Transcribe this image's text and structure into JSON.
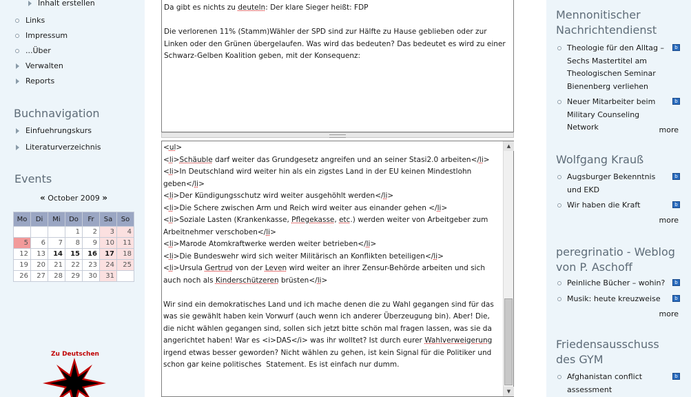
{
  "left_sidebar": {
    "top_item": "Inhalt erstellen",
    "nav_items": [
      {
        "label": "Links",
        "marker": "bullet"
      },
      {
        "label": "Impressum",
        "marker": "bullet"
      },
      {
        "label": "...Über",
        "marker": "bullet"
      },
      {
        "label": "Verwalten",
        "marker": "triangle"
      },
      {
        "label": "Reports",
        "marker": "triangle"
      }
    ],
    "book_nav": {
      "title": "Buchnavigation",
      "items": [
        "Einfuehrungskurs",
        "Literaturverzeichnis"
      ]
    },
    "events": {
      "title": "Events",
      "prev": "«",
      "next": "»",
      "month": "October 2009",
      "weekdays": [
        "Mo",
        "Di",
        "Mi",
        "Do",
        "Fr",
        "Sa",
        "So"
      ],
      "weeks": [
        [
          "",
          "",
          "",
          "1",
          "2",
          "3",
          "4"
        ],
        [
          "5",
          "6",
          "7",
          "8",
          "9",
          "10",
          "11"
        ],
        [
          "12",
          "13",
          "14",
          "15",
          "16",
          "17",
          "18"
        ],
        [
          "19",
          "20",
          "21",
          "22",
          "23",
          "24",
          "25"
        ],
        [
          "26",
          "27",
          "28",
          "29",
          "30",
          "31",
          ""
        ]
      ],
      "today": "5",
      "linked_days": [
        "14",
        "15",
        "16",
        "17"
      ]
    },
    "logo_caption": "Zu Deutschen"
  },
  "main": {
    "teaser": [
      "Da gibt es nichts zu deuteln: Der klare Sieger heißt: FDP",
      "",
      "Die verlorenen 11% (Stamm)Wähler der SPD sind zur Hälfte zu Hause geblieben oder zur Linken oder den Grünen übergelaufen. Was wird das bedeuten? Das bedeutet es wird zu einer Schwarz-Gelben Koalition geben, mit der Konsequenz:"
    ],
    "body": [
      "<ul>",
      "<li>Schäuble darf weiter das Grundgesetz angreifen und an seiner Stasi2.0 arbeiten</li>",
      "<li>In Deutschland wird weiter hin als ein zigstes Land in der EU keinen Mindestlohn geben</li>",
      "<li>Der Kündigungsschutz wird weiter ausgehöhlt werden</li>",
      "<li>Die Schere zwischen Arm und Reich wird weiter aus einander gehen </li>",
      "<li>Soziale Lasten (Krankenkasse, Pflegekasse, etc.) werden weiter von Arbeitgeber zum Arbeitnehmer verschoben</li>",
      "<li>Marode Atomkraftwerke werden weiter betrieben</li>",
      "<li>Die Bundeswehr wird sich weiter Militärisch an Konflikten beteiligen</li>",
      "<li>Ursula Gertrud von der Leven wird weiter an ihrer Zensur-Behörde arbeiten und sich auch noch als Kinderschützeren brüsten</li>",
      "",
      "Wir sind ein demokratisches Land und ich mache denen die zu Wahl gegangen sind für das was sie gewählt haben kein Vorwurf (auch wenn ich anderer Überzeugung bin). Aber! Die, die nicht wählen gegangen sind, sollen sich jetzt bitte schön mal fragen lassen, was sie da angerichtet haben! War es <i>DAS</i> was ihr wolltet? Ist durch eurer Wahlverweigerung irgend etwas besser geworden? Nicht wählen zu gehen, ist kein Signal für die Politiker und schon gar keine politisches  Statement. Es ist einfach nur dumm."
    ],
    "scroll_up": "▲",
    "scroll_down": "▼"
  },
  "right_sidebar": {
    "blocks": [
      {
        "title": "Mennonitischer Nachrichtendienst",
        "items": [
          "Theologie für den Alltag – Sechs Mastertitel am Theologischen Seminar Bienenberg verliehen",
          "Neuer Mitarbeiter beim Military Counseling Network"
        ],
        "more": "more"
      },
      {
        "title": "Wolfgang Krauß",
        "items": [
          "Augsburger Bekenntnis und EKD",
          "Wir haben die Kraft"
        ],
        "more": "more"
      },
      {
        "title": "peregrinatio - Weblog von P. Aschoff",
        "items": [
          "Peinliche Bücher – wohin?",
          "Musik: heute kreuzweise"
        ],
        "more": "more"
      },
      {
        "title": "Friedensausschuss des GYM",
        "items": [
          "Afghanistan conflict assessment"
        ],
        "more": ""
      }
    ],
    "feed_icon_glyph": "b"
  },
  "colors": {
    "sidebar_bg": "#edf5fa",
    "calendar_header": "#9aa6c3",
    "calendar_weekend": "#fbe0e0",
    "calendar_today": "#f29a9a",
    "feed_icon": "#2a6cbf",
    "logo_red": "#c00000"
  }
}
